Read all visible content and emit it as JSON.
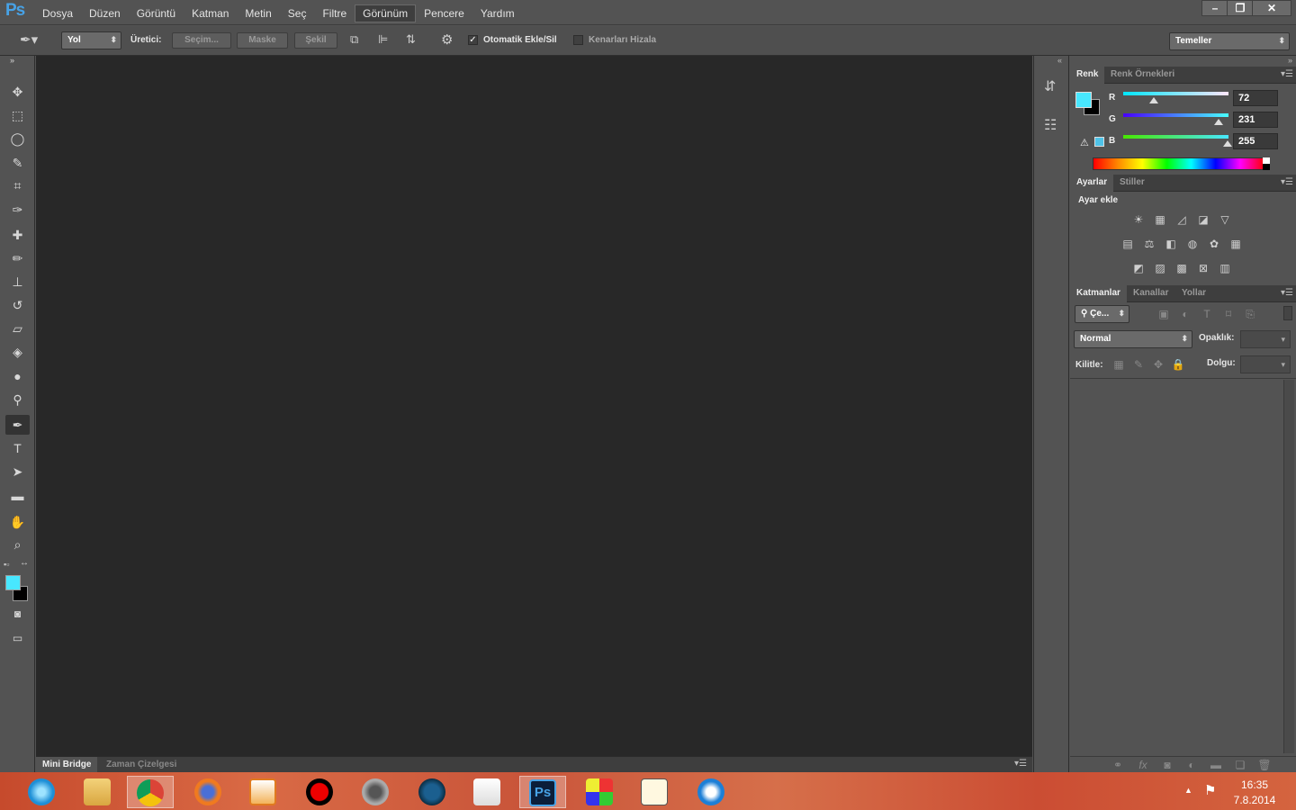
{
  "app": {
    "logo": "Ps"
  },
  "menu": [
    "Dosya",
    "Düzen",
    "Görüntü",
    "Katman",
    "Metin",
    "Seç",
    "Filtre",
    "Görünüm",
    "Pencere",
    "Yardım"
  ],
  "menu_active_index": 7,
  "window_controls": {
    "minimize": "–",
    "restore": "❐",
    "close": "✕"
  },
  "options": {
    "mode_select": "Yol",
    "producer_label": "Üretici:",
    "btn_selection": "Seçim...",
    "btn_mask": "Maske",
    "btn_shape": "Şekil",
    "auto_add_label": "Otomatik Ekle/Sil",
    "auto_add_checked": true,
    "align_edges_label": "Kenarları Hizala",
    "align_edges_checked": false,
    "workspace": "Temeller"
  },
  "bottom_tabs": [
    "Mini Bridge",
    "Zaman Çizelgesi"
  ],
  "color_panel": {
    "tabs": [
      "Renk",
      "Renk Örnekleri"
    ],
    "channels": [
      {
        "label": "R",
        "value": "72"
      },
      {
        "label": "G",
        "value": "231"
      },
      {
        "label": "B",
        "value": "255"
      }
    ],
    "foreground": "#48e7ff",
    "background": "#000000"
  },
  "adjustments_panel": {
    "tabs": [
      "Ayarlar",
      "Stiller"
    ],
    "heading": "Ayar ekle"
  },
  "layers_panel": {
    "tabs": [
      "Katmanlar",
      "Kanallar",
      "Yollar"
    ],
    "filter_label": "Çe...",
    "blend_mode": "Normal",
    "opacity_label": "Opaklık:",
    "lock_label": "Kilitle:",
    "fill_label": "Dolgu:"
  },
  "taskbar": {
    "time": "16:35",
    "date": "7.8.2014",
    "ps_label": "Ps"
  }
}
